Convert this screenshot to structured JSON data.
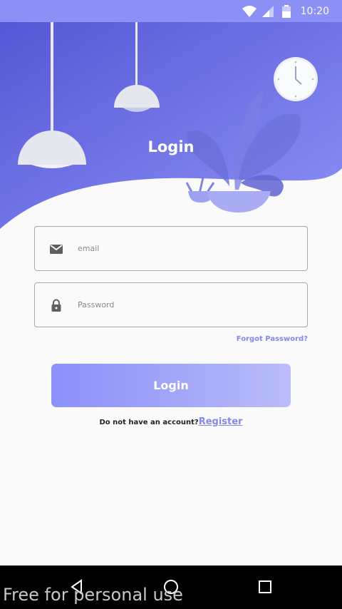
{
  "status_bar": {
    "time": "10:20"
  },
  "header": {
    "title": "Login"
  },
  "form": {
    "email_placeholder": "email",
    "password_placeholder": "Password",
    "forgot_label": "Forgot Password?",
    "login_button": "Login",
    "no_account_text": "Do not have an account?",
    "register_link": "Register"
  },
  "overlay": {
    "watermark": "Free for personal use"
  },
  "colors": {
    "accent": "#8c90fb",
    "header_gradient_start": "#5557d6",
    "header_gradient_end": "#8c8ff3",
    "link": "#8488e8"
  },
  "icons": [
    "wifi-icon",
    "signal-icon",
    "battery-icon",
    "email-icon",
    "lock-icon",
    "back-icon",
    "home-icon",
    "recents-icon",
    "lamp-illustration",
    "clock-illustration",
    "plant-illustration"
  ]
}
